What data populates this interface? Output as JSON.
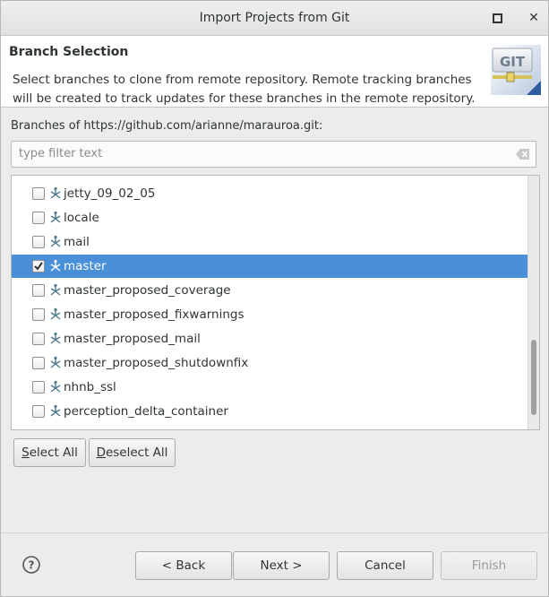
{
  "window": {
    "title": "Import Projects from Git"
  },
  "header": {
    "title": "Branch Selection",
    "description": "Select branches to clone from remote repository. Remote tracking branches will be created to track updates for these branches in the remote repository.",
    "logo_text": "GIT"
  },
  "branches": {
    "label": "Branches of https://github.com/arianne/marauroa.git:",
    "filter_placeholder": "type filter text",
    "items": [
      {
        "name": "jetty_09_02_05",
        "checked": false
      },
      {
        "name": "locale",
        "checked": false
      },
      {
        "name": "mail",
        "checked": false
      },
      {
        "name": "master",
        "checked": true,
        "selected": true
      },
      {
        "name": "master_proposed_coverage",
        "checked": false
      },
      {
        "name": "master_proposed_fixwarnings",
        "checked": false
      },
      {
        "name": "master_proposed_mail",
        "checked": false
      },
      {
        "name": "master_proposed_shutdownfix",
        "checked": false
      },
      {
        "name": "nhnb_ssl",
        "checked": false
      },
      {
        "name": "perception_delta_container",
        "checked": false
      }
    ]
  },
  "selection_buttons": {
    "select_all_mnemonic": "S",
    "select_all_rest": "elect All",
    "deselect_all_mnemonic": "D",
    "deselect_all_rest": "eselect All"
  },
  "footer": {
    "back": "< Back",
    "next": "Next >",
    "cancel": "Cancel",
    "finish": "Finish"
  },
  "colors": {
    "selection": "#4a90d9",
    "background": "#ececec"
  }
}
